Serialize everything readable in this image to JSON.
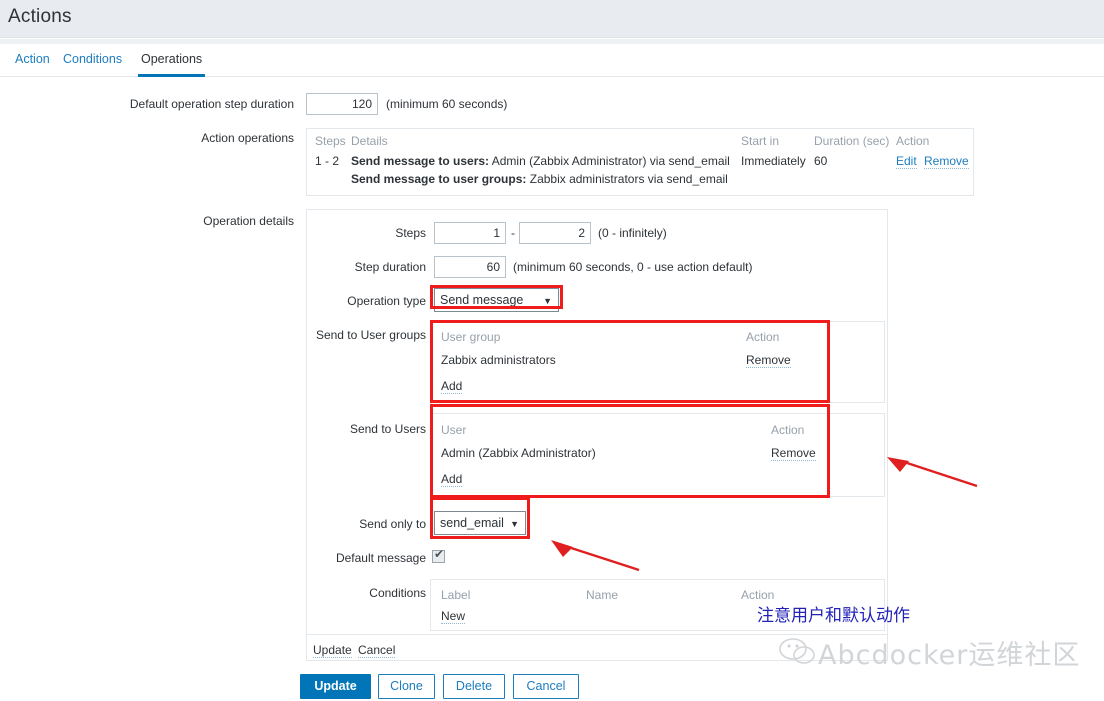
{
  "header": {
    "title": "Actions"
  },
  "tabs": [
    {
      "label": "Action",
      "active": false
    },
    {
      "label": "Conditions",
      "active": false
    },
    {
      "label": "Operations",
      "active": true
    }
  ],
  "form": {
    "default_step_duration": {
      "label": "Default operation step duration",
      "value": "120",
      "hint": "(minimum 60 seconds)"
    },
    "action_operations": {
      "label": "Action operations",
      "columns": [
        "Steps",
        "Details",
        "Start in",
        "Duration (sec)",
        "Action"
      ],
      "rows": [
        {
          "steps": "1 - 2",
          "details_line1_bold": "Send message to users:",
          "details_line1_rest": "Admin (Zabbix Administrator) via send_email",
          "details_line2_bold": "Send message to user groups:",
          "details_line2_rest": "Zabbix administrators via send_email",
          "start_in": "Immediately",
          "duration": "60",
          "actions": [
            "Edit",
            "Remove"
          ]
        }
      ]
    },
    "operation_details": {
      "label": "Operation details",
      "steps": {
        "label": "Steps",
        "from": "1",
        "separator": "-",
        "to": "2",
        "hint": "(0 - infinitely)"
      },
      "step_duration": {
        "label": "Step duration",
        "value": "60",
        "hint": "(minimum 60 seconds, 0 - use action default)"
      },
      "operation_type": {
        "label": "Operation type",
        "value": "Send message",
        "caret": "▼"
      },
      "send_to_user_groups": {
        "label": "Send to User groups",
        "columns": [
          "User group",
          "Action"
        ],
        "rows": [
          {
            "name": "Zabbix administrators",
            "action": "Remove"
          }
        ],
        "add_label": "Add"
      },
      "send_to_users": {
        "label": "Send to Users",
        "columns": [
          "User",
          "Action"
        ],
        "rows": [
          {
            "name": "Admin (Zabbix Administrator)",
            "action": "Remove"
          }
        ],
        "add_label": "Add"
      },
      "send_only_to": {
        "label": "Send only to",
        "value": "send_email",
        "caret": "▼"
      },
      "default_message": {
        "label": "Default message",
        "checked": true,
        "tick": "✔"
      },
      "conditions": {
        "label": "Conditions",
        "columns": [
          "Label",
          "Name",
          "Action"
        ],
        "rows": [],
        "new_label": "New"
      },
      "footer_links": [
        "Update",
        "Cancel"
      ]
    }
  },
  "buttons": [
    {
      "label": "Update",
      "primary": true
    },
    {
      "label": "Clone",
      "primary": false
    },
    {
      "label": "Delete",
      "primary": false
    },
    {
      "label": "Cancel",
      "primary": false
    }
  ],
  "annotations": {
    "note_text": "注意用户和默认动作",
    "note_color": "#2222b8",
    "highlight_color": "#f01c1c",
    "arrow_color": "#e02020"
  },
  "watermark": {
    "text": "Abcdocker运维社区"
  }
}
